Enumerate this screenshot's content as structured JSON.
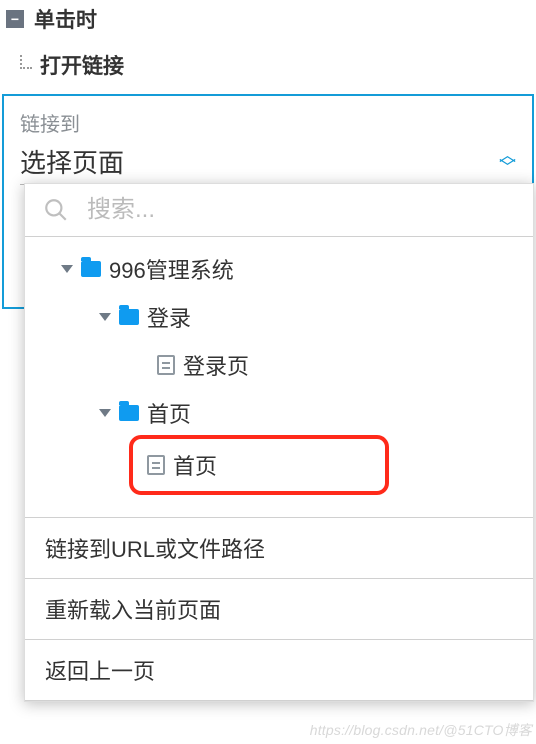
{
  "event": {
    "title": "单击时",
    "action": "打开链接"
  },
  "linkPanel": {
    "label": "链接到",
    "selectValue": "选择页面"
  },
  "dropdown": {
    "searchPlaceholder": "搜索...",
    "tree": {
      "root": "996管理系统",
      "loginFolder": "登录",
      "loginPage": "登录页",
      "homeFolder": "首页",
      "homePage": "首页"
    },
    "options": {
      "url": "链接到URL或文件路径",
      "reload": "重新载入当前页面",
      "back": "返回上一页"
    }
  },
  "watermark": "https://blog.csdn.net/@51CTO博客"
}
